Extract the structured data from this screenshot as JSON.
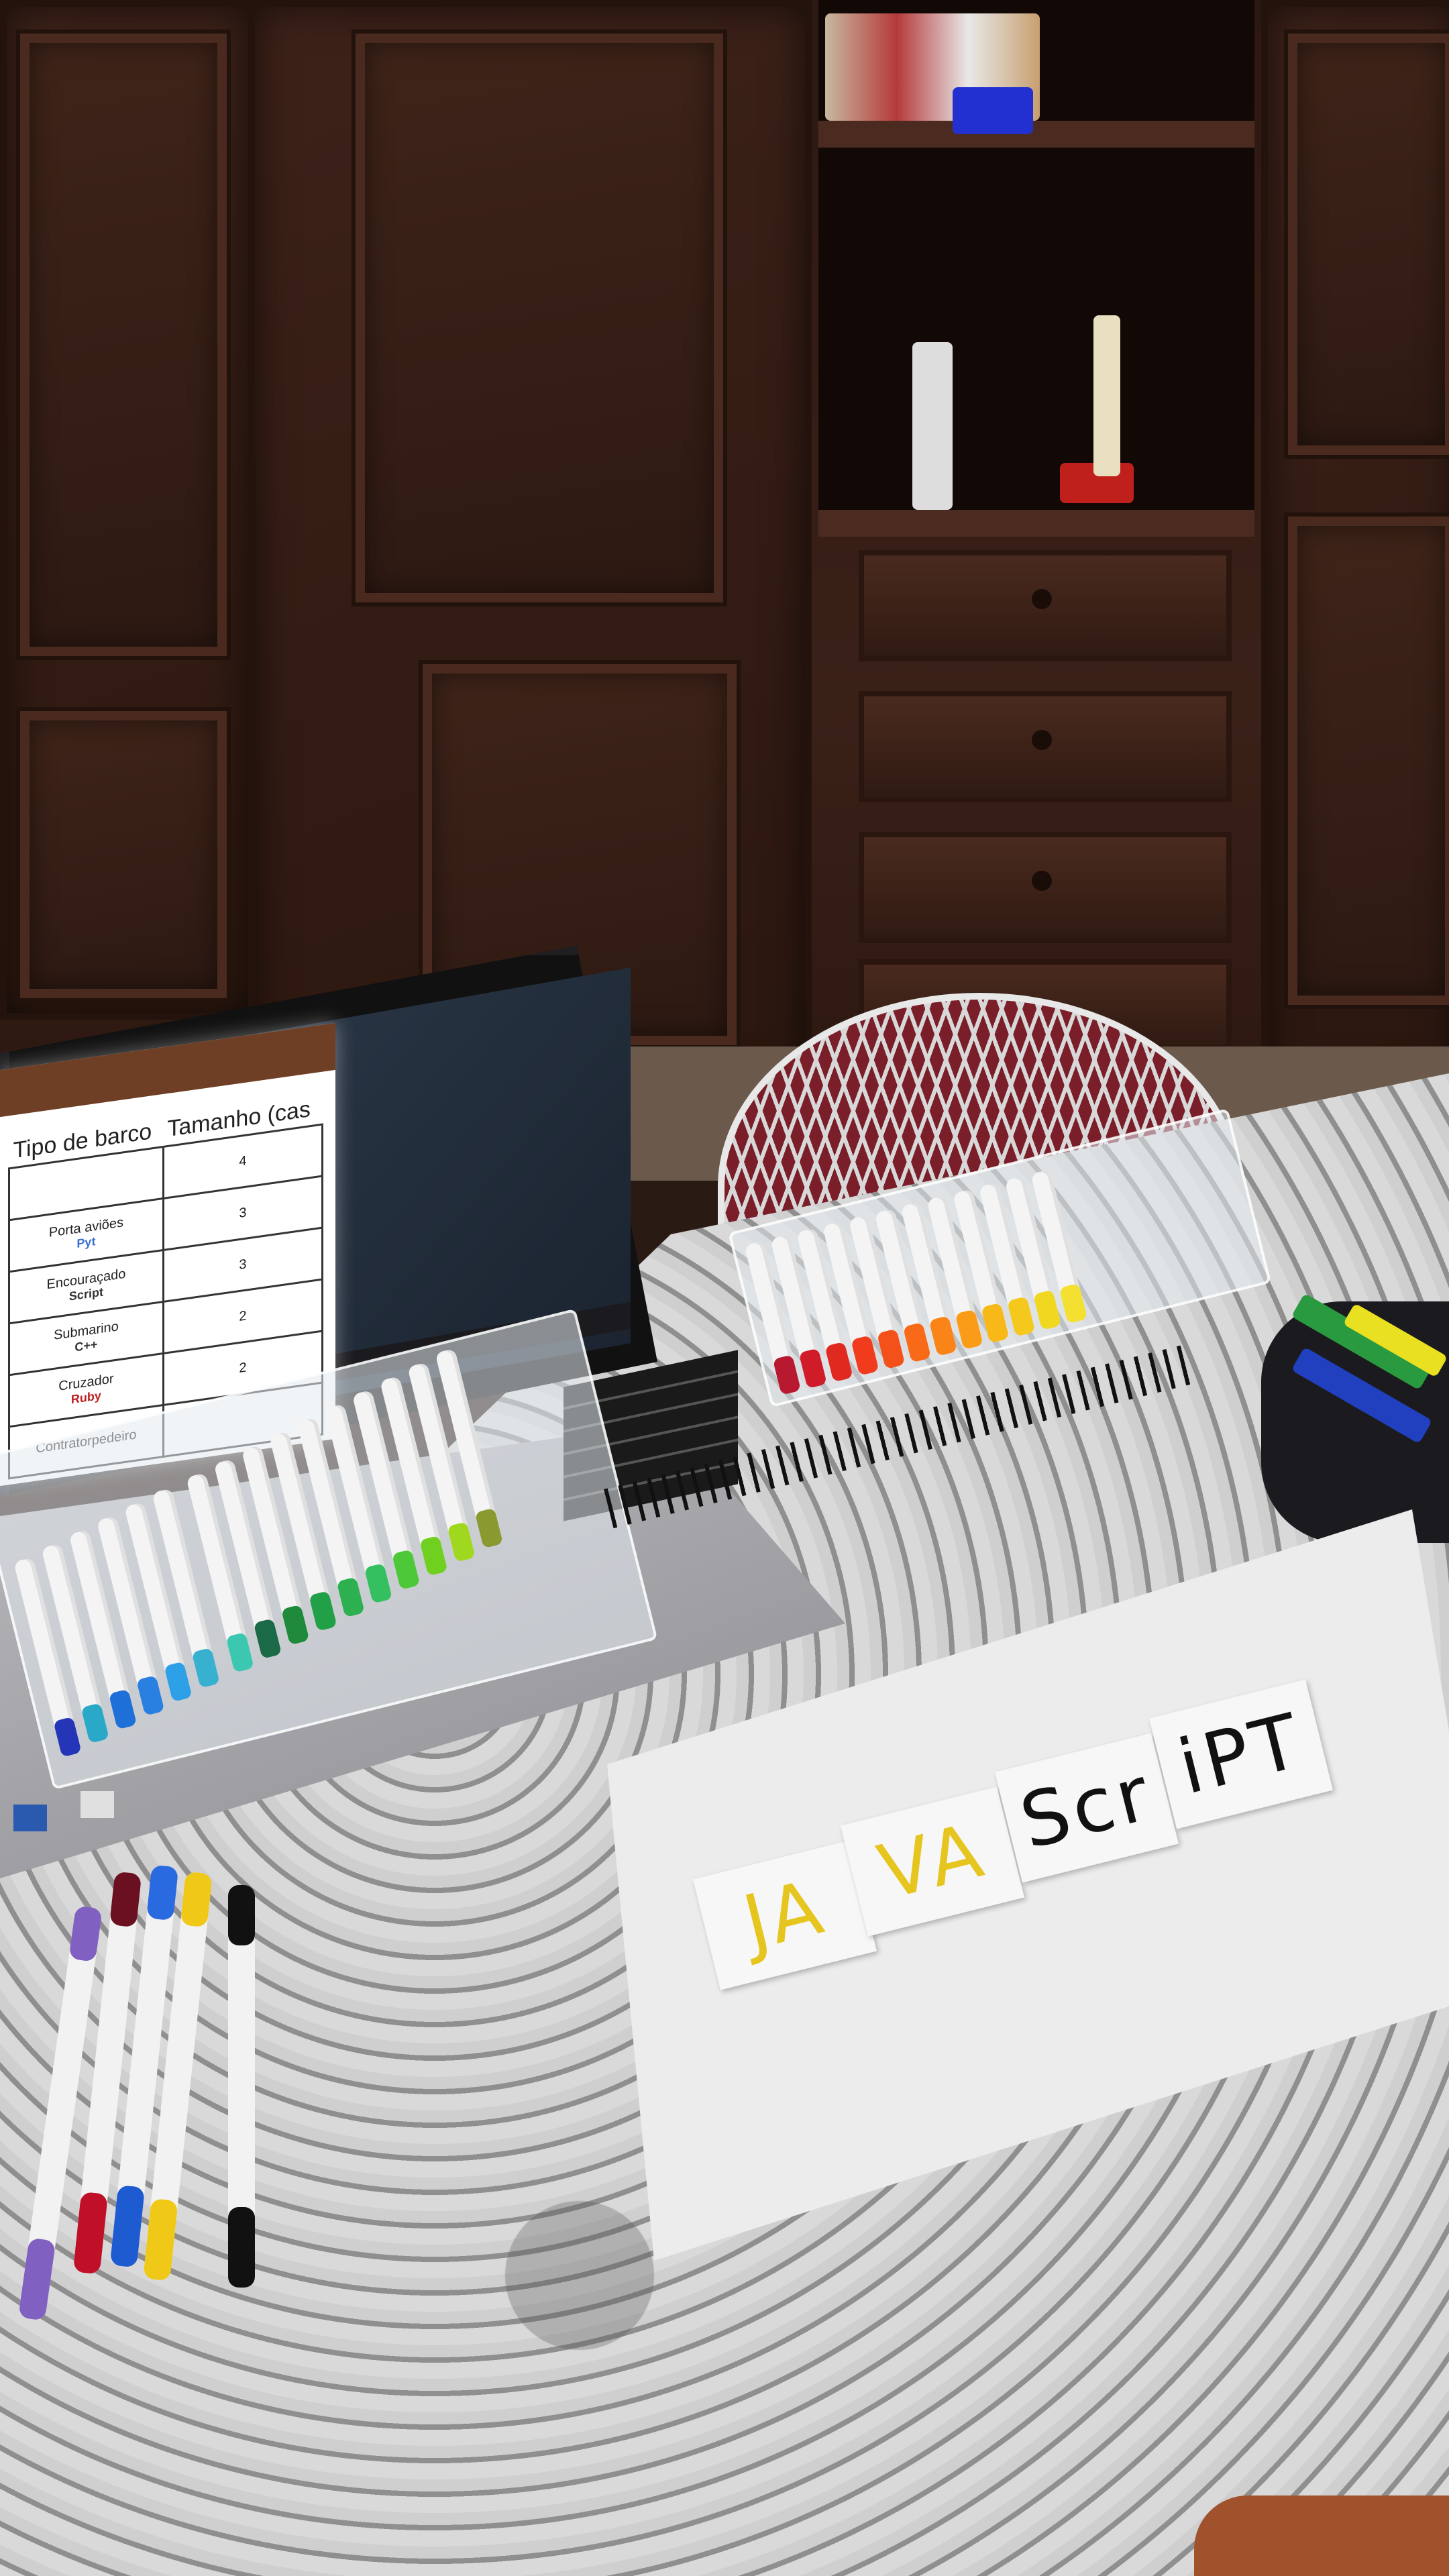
{
  "laptop_screen": {
    "table": {
      "headers": [
        "Tipo de barco",
        "Tamanho (cas"
      ],
      "rows": [
        {
          "ship": "",
          "language": "",
          "size": "4"
        },
        {
          "ship": "Porta aviões",
          "language": "Pyt",
          "size": "3"
        },
        {
          "ship": "Encouraçado",
          "language": "Script",
          "size": "3"
        },
        {
          "ship": "Submarino",
          "language": "C++",
          "size": "2"
        },
        {
          "ship": "Cruzador",
          "language": "Ruby",
          "size": "2"
        },
        {
          "ship": "Contratorpedeiro",
          "language": "",
          "size": ""
        }
      ]
    }
  },
  "notebook": {
    "cards": [
      "JA",
      "VA",
      "Scr",
      "iPT"
    ]
  },
  "colors": {
    "card_yellow": "#e5c51e",
    "card_black": "#111111",
    "browser_bar": "#6e3f24"
  }
}
